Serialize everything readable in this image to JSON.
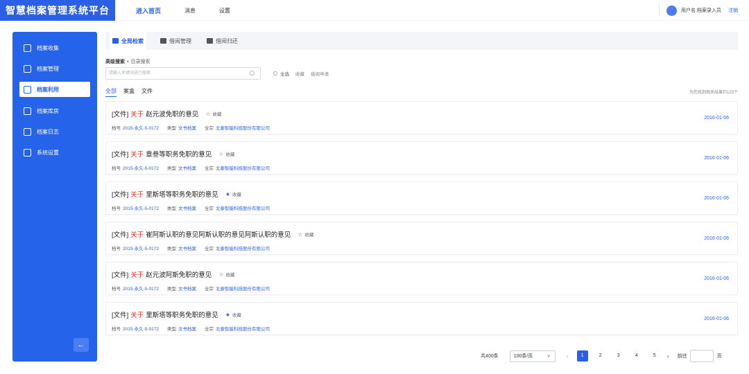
{
  "app": {
    "title": "智慧档案管理系统平台"
  },
  "topnav": [
    "进入首页",
    "消息",
    "设置"
  ],
  "user": {
    "label": "用户名:档案录入员",
    "logout": "注销"
  },
  "sidebar": {
    "items": [
      {
        "label": "档案收集",
        "icon": "inbox-icon"
      },
      {
        "label": "档案管理",
        "icon": "folder-icon"
      },
      {
        "label": "档案利用",
        "icon": "image-icon"
      },
      {
        "label": "档案库房",
        "icon": "warehouse-icon"
      },
      {
        "label": "档案日志",
        "icon": "log-icon"
      },
      {
        "label": "系统设置",
        "icon": "settings-icon"
      }
    ],
    "back_label": "←"
  },
  "tabs": [
    "全局检索",
    "借阅管理",
    "借阅归还"
  ],
  "search": {
    "advanced_label": "高级搜索",
    "dot": "•",
    "dir_label": "目录搜索",
    "placeholder": "请输入关键词进行搜索",
    "filters": [
      "全选",
      "收藏",
      "借阅申请"
    ]
  },
  "subtabs": [
    "全部",
    "案盒",
    "文件"
  ],
  "results_text": "为您找到相关结果约123个",
  "labels": {
    "doc_no": "档号",
    "type": "类型",
    "fonds": "全宗",
    "favorite": "收藏",
    "keyword": "关于",
    "prefix": "[文件]"
  },
  "results": [
    {
      "title": "赵元波免职的意见",
      "fav": false,
      "doc_no": "2015-永久-5-0172",
      "type": "文书档案",
      "fonds": "北泰智能科技股份有限公司",
      "date": "2016-01-06"
    },
    {
      "title": "章叁等职务免职的意见",
      "fav": false,
      "doc_no": "2015-永久-5-0172",
      "type": "文书档案",
      "fonds": "北泰智能科技股份有限公司",
      "date": "2016-01-06"
    },
    {
      "title": "里斯塔等职务免职的意见",
      "fav": true,
      "doc_no": "2015-永久-5-0172",
      "type": "文书档案",
      "fonds": "北泰智能科技股份有限公司",
      "date": "2016-01-06"
    },
    {
      "title": "崔阿斯认职的意见阿斯认职的意见阿斯认职的意见",
      "fav": false,
      "doc_no": "2015-永久-5-0172",
      "type": "文书档案",
      "fonds": "北泰智能科技股份有限公司",
      "date": "2016-01-06"
    },
    {
      "title": "赵元波阿斯免职的意见",
      "fav": false,
      "doc_no": "2015-永久-5-0172",
      "type": "文书档案",
      "fonds": "北泰智能科技股份有限公司",
      "date": "2016-01-06"
    },
    {
      "title": "里斯塔等职务免职的意见",
      "fav": true,
      "doc_no": "2015-永久-5-0172",
      "type": "文书档案",
      "fonds": "北泰智能科技股份有限公司",
      "date": "2016-01-06"
    }
  ],
  "pagination": {
    "total": "共400条",
    "page_size": "100条/页",
    "pages": [
      "1",
      "2",
      "3",
      "4",
      "5"
    ],
    "current": "1",
    "goto_label": "前往",
    "page_suffix": "页"
  },
  "colors": {
    "primary": "#2a5fe6",
    "keyword": "#e03a2e"
  }
}
